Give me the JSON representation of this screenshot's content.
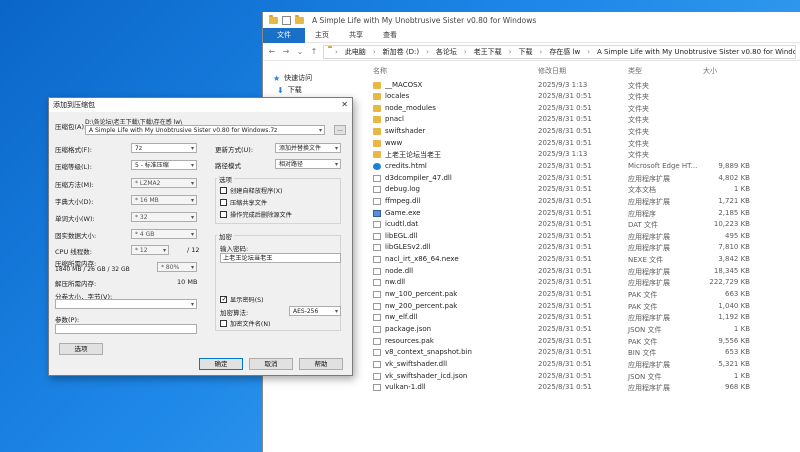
{
  "explorer": {
    "title": "A Simple Life with My Unobtrusive Sister v0.80 for Windows",
    "ribbon_tabs": [
      "文件",
      "主页",
      "共享",
      "查看"
    ],
    "breadcrumb": [
      "此电脑",
      "新加卷 (D:)",
      "各论坛",
      "老王下载",
      "下载",
      "存在感 lw",
      "A Simple Life with My Unobtrusive Sister v0.80 for Windows"
    ],
    "nav": [
      {
        "label": "快速访问",
        "icon": "star-icon"
      },
      {
        "label": "下载",
        "icon": "download-icon"
      }
    ],
    "columns": {
      "name": "名称",
      "date": "修改日期",
      "type": "类型",
      "size": "大小"
    },
    "files": [
      {
        "name": "__MACOSX",
        "date": "2025/9/3 1:13",
        "type": "文件夹",
        "size": "",
        "icon": "folder"
      },
      {
        "name": "locales",
        "date": "2025/8/31 0:51",
        "type": "文件夹",
        "size": "",
        "icon": "folder"
      },
      {
        "name": "node_modules",
        "date": "2025/8/31 0:51",
        "type": "文件夹",
        "size": "",
        "icon": "folder"
      },
      {
        "name": "pnacl",
        "date": "2025/8/31 0:51",
        "type": "文件夹",
        "size": "",
        "icon": "folder"
      },
      {
        "name": "swiftshader",
        "date": "2025/8/31 0:51",
        "type": "文件夹",
        "size": "",
        "icon": "folder"
      },
      {
        "name": "www",
        "date": "2025/8/31 0:51",
        "type": "文件夹",
        "size": "",
        "icon": "folder"
      },
      {
        "name": "上老王论坛当老王",
        "date": "2025/9/3 1:13",
        "type": "文件夹",
        "size": "",
        "icon": "folder"
      },
      {
        "name": "credits.html",
        "date": "2025/8/31 0:51",
        "type": "Microsoft Edge HT...",
        "size": "9,889 KB",
        "icon": "edge"
      },
      {
        "name": "d3dcompiler_47.dll",
        "date": "2025/8/31 0:51",
        "type": "应用程序扩展",
        "size": "4,802 KB",
        "icon": "file"
      },
      {
        "name": "debug.log",
        "date": "2025/8/31 0:51",
        "type": "文本文档",
        "size": "1 KB",
        "icon": "file"
      },
      {
        "name": "ffmpeg.dll",
        "date": "2025/8/31 0:51",
        "type": "应用程序扩展",
        "size": "1,721 KB",
        "icon": "file"
      },
      {
        "name": "Game.exe",
        "date": "2025/8/31 0:51",
        "type": "应用程序",
        "size": "2,185 KB",
        "icon": "exe"
      },
      {
        "name": "icudtl.dat",
        "date": "2025/8/31 0:51",
        "type": "DAT 文件",
        "size": "10,223 KB",
        "icon": "file"
      },
      {
        "name": "libEGL.dll",
        "date": "2025/8/31 0:51",
        "type": "应用程序扩展",
        "size": "495 KB",
        "icon": "file"
      },
      {
        "name": "libGLESv2.dll",
        "date": "2025/8/31 0:51",
        "type": "应用程序扩展",
        "size": "7,810 KB",
        "icon": "file"
      },
      {
        "name": "nacl_irt_x86_64.nexe",
        "date": "2025/8/31 0:51",
        "type": "NEXE 文件",
        "size": "3,842 KB",
        "icon": "file"
      },
      {
        "name": "node.dll",
        "date": "2025/8/31 0:51",
        "type": "应用程序扩展",
        "size": "18,345 KB",
        "icon": "file"
      },
      {
        "name": "nw.dll",
        "date": "2025/8/31 0:51",
        "type": "应用程序扩展",
        "size": "222,729 KB",
        "icon": "file"
      },
      {
        "name": "nw_100_percent.pak",
        "date": "2025/8/31 0:51",
        "type": "PAK 文件",
        "size": "663 KB",
        "icon": "file"
      },
      {
        "name": "nw_200_percent.pak",
        "date": "2025/8/31 0:51",
        "type": "PAK 文件",
        "size": "1,040 KB",
        "icon": "file"
      },
      {
        "name": "nw_elf.dll",
        "date": "2025/8/31 0:51",
        "type": "应用程序扩展",
        "size": "1,192 KB",
        "icon": "file"
      },
      {
        "name": "package.json",
        "date": "2025/8/31 0:51",
        "type": "JSON 文件",
        "size": "1 KB",
        "icon": "json"
      },
      {
        "name": "resources.pak",
        "date": "2025/8/31 0:51",
        "type": "PAK 文件",
        "size": "9,556 KB",
        "icon": "file"
      },
      {
        "name": "v8_context_snapshot.bin",
        "date": "2025/8/31 0:51",
        "type": "BIN 文件",
        "size": "653 KB",
        "icon": "file"
      },
      {
        "name": "vk_swiftshader.dll",
        "date": "2025/8/31 0:51",
        "type": "应用程序扩展",
        "size": "5,321 KB",
        "icon": "file"
      },
      {
        "name": "vk_swiftshader_icd.json",
        "date": "2025/8/31 0:51",
        "type": "JSON 文件",
        "size": "1 KB",
        "icon": "json"
      },
      {
        "name": "vulkan-1.dll",
        "date": "2025/8/31 0:51",
        "type": "应用程序扩展",
        "size": "968 KB",
        "icon": "file"
      }
    ]
  },
  "dialog": {
    "title": "添加到压缩包",
    "close": "✕",
    "archive_label": "压缩包(A):",
    "archive_dir": "D:\\各论坛\\老王下载\\下载\\存在感 lw\\",
    "archive_name": "A Simple Life with My Unobtrusive Sister v0.80 for Windows.7z",
    "browse": "...",
    "format_label": "压缩格式(F):",
    "format_value": "7z",
    "level_label": "压缩等级(L):",
    "level_value": "5 - 标准压缩",
    "method_label": "压缩方法(M):",
    "method_value": "* LZMA2",
    "dict_label": "字典大小(D):",
    "dict_value": "* 16 MB",
    "word_label": "单词大小(W):",
    "word_value": "* 32",
    "solid_label": "固实数据大小:",
    "solid_value": "* 4 GB",
    "cpu_label": "CPU 线程数:",
    "cpu_value": "* 12",
    "cpu_total": "/ 12",
    "mem_comp_label": "压缩所需内存:",
    "mem_comp_value": "1840 MB / 26 GB / 32 GB",
    "mem_percent": "* 80%",
    "mem_decomp_label": "解压所需内存:",
    "mem_decomp_value": "10 MB",
    "split_label": "分卷大小，字节(V):",
    "params_label": "参数(P):",
    "options_button": "选项",
    "update_label": "更新方式(U):",
    "update_value": "添加并替换文件",
    "path_label": "路径模式",
    "path_value": "相对路径",
    "options_group": "选项",
    "opt_sfx": "创建自释放程序(X)",
    "opt_shared": "压缩共享文件",
    "opt_delete": "操作完成后删除源文件",
    "encrypt_group": "加密",
    "password_label": "输入密码:",
    "password_value": "上老王论坛当老王",
    "show_password": "显示密码(S)",
    "enc_method_label": "加密算法:",
    "enc_method_value": "AES-256",
    "encrypt_names": "加密文件名(N)",
    "ok": "确定",
    "cancel": "取消",
    "help": "帮助"
  }
}
